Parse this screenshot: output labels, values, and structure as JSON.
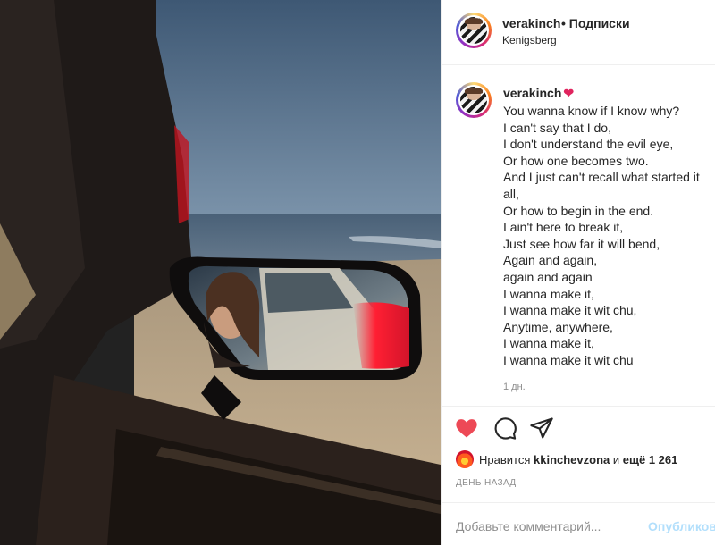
{
  "post": {
    "username": "verakinch",
    "follow_label": "• Подписки",
    "location": "Kenigsberg"
  },
  "caption": {
    "username": "verakinch",
    "emoji": "❤",
    "lines": [
      "You wanna know if I know why?",
      "I can't say that I do,",
      "I don't understand the evil eye,",
      "Or how one becomes two.",
      "And I just can't recall what started it all,",
      "Or how to begin in the end.",
      "I ain't here to break it,",
      "Just see how far it will bend,",
      "Again and again,",
      "again and again",
      "I wanna make it,",
      "I wanna make it wit chu,",
      "Anytime, anywhere,",
      "I wanna make it,",
      "I wanna make it wit chu"
    ],
    "time_ago": "1 дн."
  },
  "actions": {
    "like_icon": "heart-filled-icon",
    "comment_icon": "comment-icon",
    "share_icon": "share-icon",
    "like_color": "#ed4956"
  },
  "likes": {
    "prefix": "Нравится",
    "user": "kkinchevzona",
    "and": "и",
    "others": "ещё 1 261"
  },
  "date_label": "ДЕНЬ НАЗАД",
  "comment": {
    "placeholder": "Добавьте комментарий...",
    "publish_label": "Опубликовать"
  }
}
